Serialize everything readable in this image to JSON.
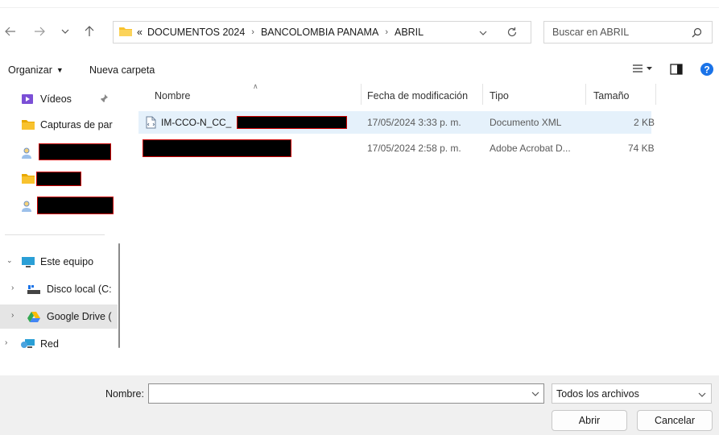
{
  "nav": {
    "address_crumbs": [
      "DOCUMENTOS 2024",
      "BANCOLOMBIA PANAMA",
      "ABRIL"
    ],
    "overflow_glyph": "«",
    "search_placeholder": "Buscar en ABRIL"
  },
  "toolbar": {
    "organize_label": "Organizar",
    "new_folder_label": "Nueva carpeta"
  },
  "navpane": {
    "items": [
      {
        "label": "Vídeos",
        "icon": "videos-folder-icon"
      },
      {
        "label": "Capturas de par",
        "icon": "folder-icon"
      },
      {
        "label": "",
        "icon": "user-folder-icon",
        "redacted": true
      },
      {
        "label": "",
        "icon": "folder-icon",
        "redacted": true
      },
      {
        "label": "",
        "icon": "user-folder-icon",
        "redacted": true
      },
      {
        "label": "Este equipo",
        "icon": "computer-icon"
      },
      {
        "label": "Disco local (C:",
        "icon": "drive-icon"
      },
      {
        "label": "Google Drive (",
        "icon": "google-drive-icon"
      },
      {
        "label": "Red",
        "icon": "network-icon"
      }
    ]
  },
  "columns": {
    "name": "Nombre",
    "modified": "Fecha de modificación",
    "type": "Tipo",
    "size": "Tamaño"
  },
  "files": [
    {
      "name": "IM-CCO-N_CC_",
      "modified": "17/05/2024 3:33 p. m.",
      "type": "Documento XML",
      "size": "2 KB",
      "selected": true,
      "name_redacted_suffix": true
    },
    {
      "name": "",
      "modified": "17/05/2024 2:58 p. m.",
      "type": "Adobe Acrobat D...",
      "size": "74 KB",
      "selected": false,
      "name_redacted": true
    }
  ],
  "bottom": {
    "filename_label": "Nombre:",
    "filename_value": "",
    "filetype_value": "Todos los archivos",
    "open_label": "Abrir",
    "cancel_label": "Cancelar"
  },
  "colors": {
    "selection": "#e5f1fb",
    "nav_selected": "#e5e5e5",
    "folder_yellow": "#f8c22e",
    "help_blue": "#1a73e8",
    "bottom_bg": "#f0f0f0"
  }
}
